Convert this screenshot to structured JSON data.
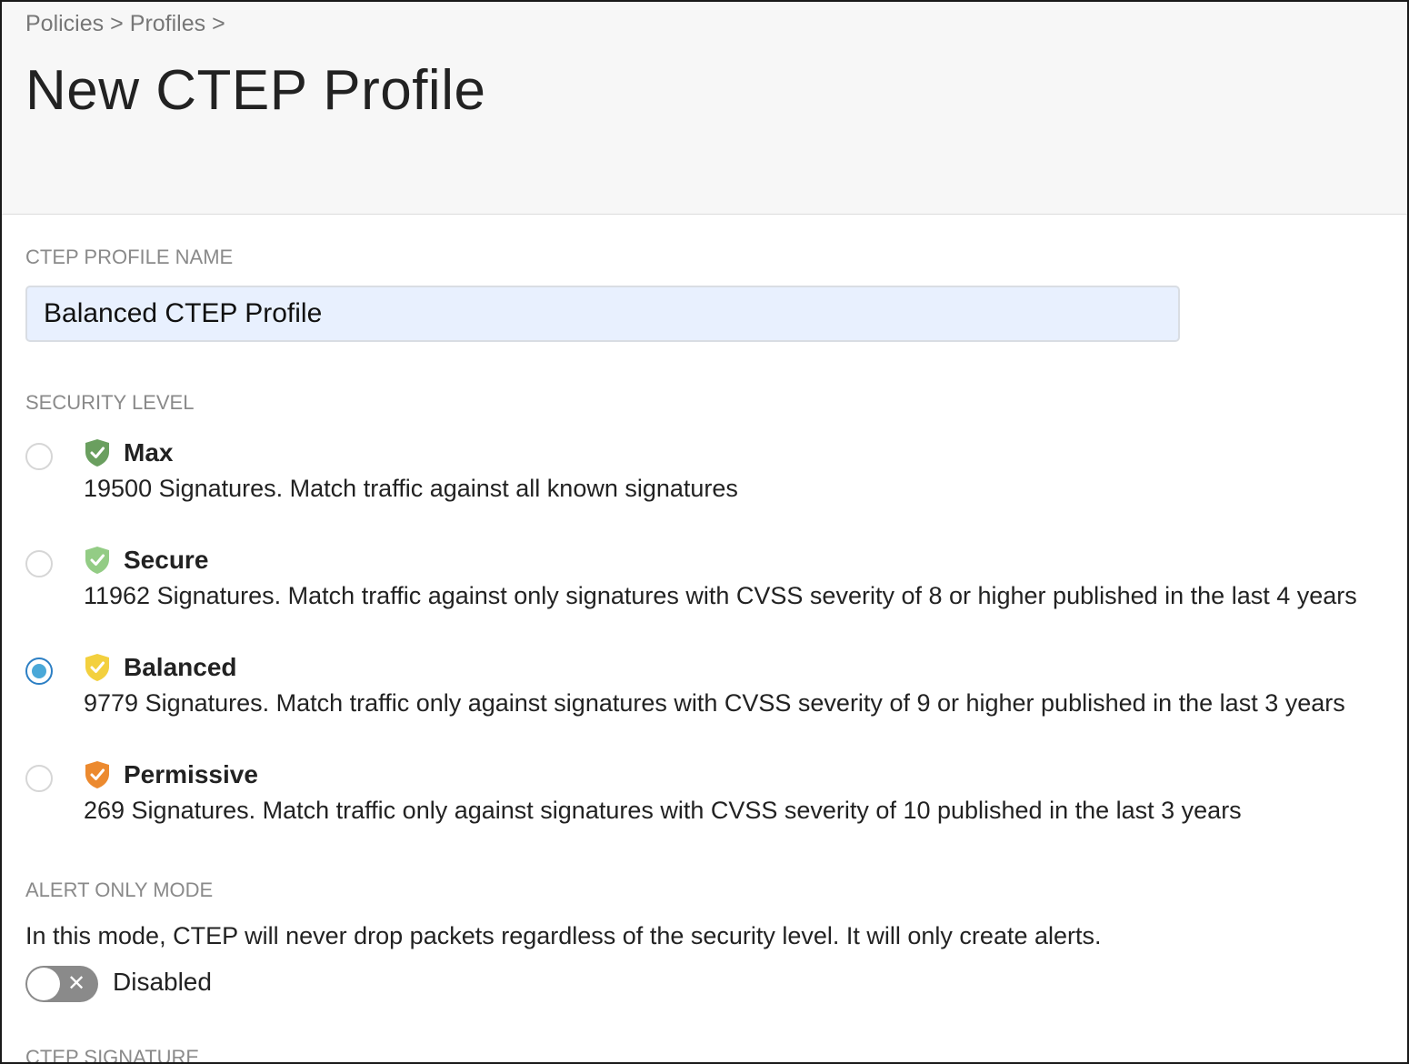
{
  "breadcrumb": {
    "items": [
      "Policies",
      ">",
      "Profiles",
      ">"
    ]
  },
  "page": {
    "title": "New CTEP Profile"
  },
  "profile_name": {
    "label": "CTEP PROFILE NAME",
    "value": "Balanced CTEP Profile"
  },
  "security_level": {
    "label": "SECURITY LEVEL",
    "selected": "Balanced",
    "options": [
      {
        "title": "Max",
        "description": "19500 Signatures. Match traffic against all known signatures",
        "shield_color": "#6a9f5f",
        "icon": "shield-check-icon"
      },
      {
        "title": "Secure",
        "description": "11962 Signatures. Match traffic against only signatures with CVSS severity of 8 or higher published in the last 4 years",
        "shield_color": "#93cc85",
        "icon": "shield-check-icon"
      },
      {
        "title": "Balanced",
        "description": "9779 Signatures. Match traffic only against signatures with CVSS severity of 9 or higher published in the last 3 years",
        "shield_color": "#f3d03e",
        "icon": "shield-check-icon"
      },
      {
        "title": "Permissive",
        "description": "269 Signatures. Match traffic only against signatures with CVSS severity of 10 published in the last 3 years",
        "shield_color": "#ec8a2f",
        "icon": "shield-check-icon"
      }
    ]
  },
  "alert_only": {
    "label": "ALERT ONLY MODE",
    "description": "In this mode, CTEP will never drop packets regardless of the security level. It will only create alerts.",
    "toggle_state": "Disabled",
    "toggle_icon": "close-icon"
  },
  "next_section": {
    "label": "CTEP SIGNATURE"
  },
  "colors": {
    "accent": "#4aa8d8",
    "input_bg": "#e8f0fe",
    "header_bg": "#f7f7f7"
  }
}
